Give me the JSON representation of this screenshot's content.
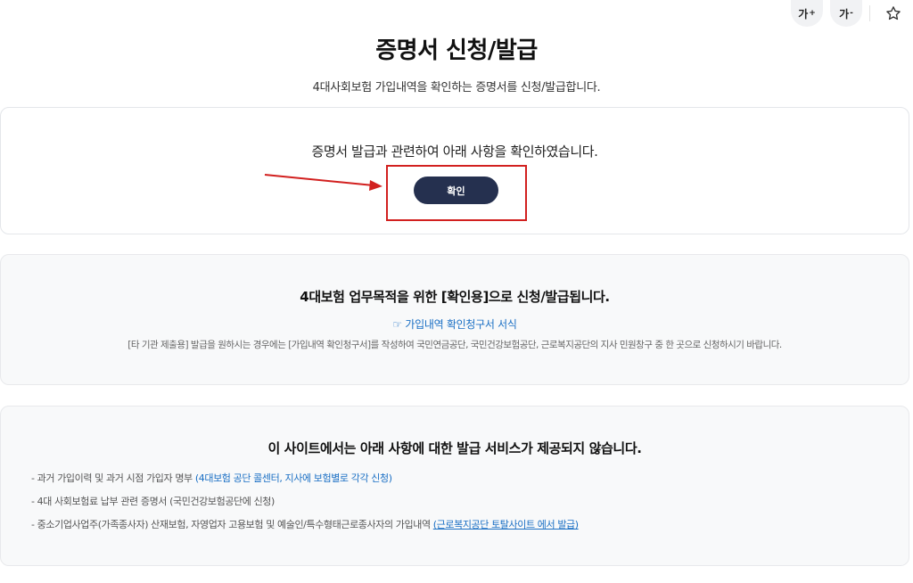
{
  "toolbar": {
    "font_increase_label": "가",
    "font_increase_mark": "+",
    "font_decrease_label": "가",
    "font_decrease_mark": "-",
    "bookmark_icon": "star-icon"
  },
  "header": {
    "title": "증명서 신청/발급",
    "subtitle": "4대사회보험 가입내역을 확인하는 증명서를 신청/발급합니다."
  },
  "confirm_section": {
    "text": "증명서 발급과 관련하여 아래 사항을 확인하였습니다.",
    "button_label": "확인",
    "highlight_color": "#d2201f"
  },
  "info_section": {
    "title": "4대보험 업무목적을 위한 [확인용]으로 신청/발급됩니다.",
    "link_icon": "☞",
    "link_text": "가입내역 확인청구서 서식",
    "description": "[타 기관 제출용] 발급을 원하시는 경우에는 [가입내역 확인청구서]를 작성하여 국민연금공단, 국민건강보험공단, 근로복지공단의 지사 민원창구 중 한 곳으로 신청하시기 바랍니다."
  },
  "notice_section": {
    "title": "이 사이트에서는 아래 사항에 대한 발급 서비스가 제공되지 않습니다.",
    "items": [
      {
        "text": "- 과거 가입이력 및 과거 시점 가입자 명부",
        "note": "(4대보험 공단 콜센터, 지사에 보험별로 각각 신청)"
      },
      {
        "text": "- 4대 사회보험료 납부 관련 증명서 (국민건강보험공단에 신청)"
      },
      {
        "text": "- 중소기업사업주(가족종사자) 산재보험, 자영업자 고용보험 및 예술인/특수형태근로종사자의 가입내역",
        "link": "(근로복지공단 토탈사이트 에서 발급)"
      }
    ]
  },
  "colors": {
    "primary_button": "#25304f",
    "link": "#1a6fc4",
    "annotation_red": "#d2201f"
  }
}
